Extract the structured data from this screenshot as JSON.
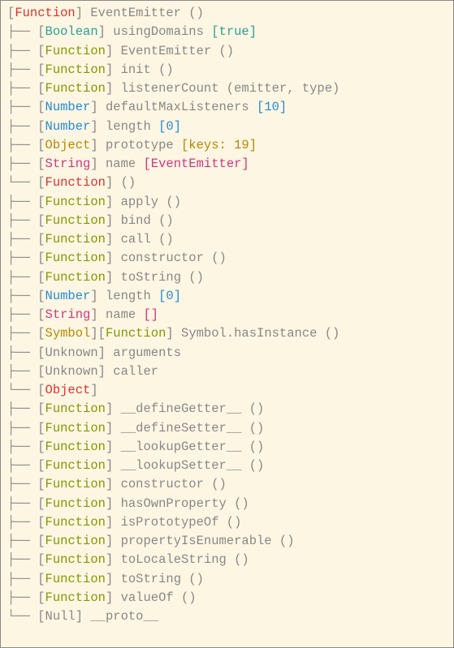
{
  "tree": [
    {
      "prefix": "",
      "types": [
        {
          "cls": "t-function-root",
          "label": "Function"
        }
      ],
      "name": "EventEmitter",
      "suffix": " ()"
    },
    {
      "prefix": "├── ",
      "types": [
        {
          "cls": "t-boolean",
          "label": "Boolean"
        }
      ],
      "name": "usingDomains",
      "suffix": " ",
      "valueCls": "val-bool",
      "value": "[true]"
    },
    {
      "prefix": "├── ",
      "types": [
        {
          "cls": "t-function",
          "label": "Function"
        }
      ],
      "name": "EventEmitter",
      "suffix": " ()"
    },
    {
      "prefix": "├── ",
      "types": [
        {
          "cls": "t-function",
          "label": "Function"
        }
      ],
      "name": "init",
      "suffix": " ()"
    },
    {
      "prefix": "├── ",
      "types": [
        {
          "cls": "t-function",
          "label": "Function"
        }
      ],
      "name": "listenerCount",
      "suffix": " (emitter, type)"
    },
    {
      "prefix": "├── ",
      "types": [
        {
          "cls": "t-number",
          "label": "Number"
        }
      ],
      "name": "defaultMaxListeners",
      "suffix": " ",
      "valueCls": "val-num",
      "value": "[10]"
    },
    {
      "prefix": "├── ",
      "types": [
        {
          "cls": "t-number",
          "label": "Number"
        }
      ],
      "name": "length",
      "suffix": " ",
      "valueCls": "val-num",
      "value": "[0]"
    },
    {
      "prefix": "├── ",
      "types": [
        {
          "cls": "t-object",
          "label": "Object"
        }
      ],
      "name": "prototype",
      "suffix": " ",
      "valueCls": "val-obj",
      "value": "[keys: 19]"
    },
    {
      "prefix": "├── ",
      "types": [
        {
          "cls": "t-string",
          "label": "String"
        }
      ],
      "name": "name",
      "suffix": " ",
      "valueCls": "val-str",
      "value": "[EventEmitter]"
    },
    {
      "prefix": "└── ",
      "types": [
        {
          "cls": "t-function-root",
          "label": "Function"
        }
      ],
      "name": "",
      "suffix": "()"
    },
    {
      "prefix": "    ├── ",
      "types": [
        {
          "cls": "t-function",
          "label": "Function"
        }
      ],
      "name": "apply",
      "suffix": " ()"
    },
    {
      "prefix": "    ├── ",
      "types": [
        {
          "cls": "t-function",
          "label": "Function"
        }
      ],
      "name": "bind",
      "suffix": " ()"
    },
    {
      "prefix": "    ├── ",
      "types": [
        {
          "cls": "t-function",
          "label": "Function"
        }
      ],
      "name": "call",
      "suffix": " ()"
    },
    {
      "prefix": "    ├── ",
      "types": [
        {
          "cls": "t-function",
          "label": "Function"
        }
      ],
      "name": "constructor",
      "suffix": " ()"
    },
    {
      "prefix": "    ├── ",
      "types": [
        {
          "cls": "t-function",
          "label": "Function"
        }
      ],
      "name": "toString",
      "suffix": " ()"
    },
    {
      "prefix": "    ├── ",
      "types": [
        {
          "cls": "t-number",
          "label": "Number"
        }
      ],
      "name": "length",
      "suffix": " ",
      "valueCls": "val-num",
      "value": "[0]"
    },
    {
      "prefix": "    ├── ",
      "types": [
        {
          "cls": "t-string",
          "label": "String"
        }
      ],
      "name": "name",
      "suffix": " ",
      "valueCls": "val-str",
      "value": "[]"
    },
    {
      "prefix": "    ├── ",
      "types": [
        {
          "cls": "t-symbol",
          "label": "Symbol"
        },
        {
          "cls": "t-function",
          "label": "Function"
        }
      ],
      "name": "Symbol.hasInstance",
      "suffix": " ()"
    },
    {
      "prefix": "    ├── ",
      "types": [
        {
          "cls": "t-unknown",
          "label": "Unknown"
        }
      ],
      "name": "arguments",
      "suffix": ""
    },
    {
      "prefix": "    ├── ",
      "types": [
        {
          "cls": "t-unknown",
          "label": "Unknown"
        }
      ],
      "name": "caller",
      "suffix": ""
    },
    {
      "prefix": "    └── ",
      "types": [
        {
          "cls": "t-object-root",
          "label": "Object"
        }
      ],
      "name": "",
      "suffix": ""
    },
    {
      "prefix": "        ├── ",
      "types": [
        {
          "cls": "t-function",
          "label": "Function"
        }
      ],
      "name": "__defineGetter__",
      "suffix": " ()"
    },
    {
      "prefix": "        ├── ",
      "types": [
        {
          "cls": "t-function",
          "label": "Function"
        }
      ],
      "name": "__defineSetter__",
      "suffix": " ()"
    },
    {
      "prefix": "        ├── ",
      "types": [
        {
          "cls": "t-function",
          "label": "Function"
        }
      ],
      "name": "__lookupGetter__",
      "suffix": " ()"
    },
    {
      "prefix": "        ├── ",
      "types": [
        {
          "cls": "t-function",
          "label": "Function"
        }
      ],
      "name": "__lookupSetter__",
      "suffix": " ()"
    },
    {
      "prefix": "        ├── ",
      "types": [
        {
          "cls": "t-function",
          "label": "Function"
        }
      ],
      "name": "constructor",
      "suffix": " ()"
    },
    {
      "prefix": "        ├── ",
      "types": [
        {
          "cls": "t-function",
          "label": "Function"
        }
      ],
      "name": "hasOwnProperty",
      "suffix": " ()"
    },
    {
      "prefix": "        ├── ",
      "types": [
        {
          "cls": "t-function",
          "label": "Function"
        }
      ],
      "name": "isPrototypeOf",
      "suffix": " ()"
    },
    {
      "prefix": "        ├── ",
      "types": [
        {
          "cls": "t-function",
          "label": "Function"
        }
      ],
      "name": "propertyIsEnumerable",
      "suffix": " ()"
    },
    {
      "prefix": "        ├── ",
      "types": [
        {
          "cls": "t-function",
          "label": "Function"
        }
      ],
      "name": "toLocaleString",
      "suffix": " ()"
    },
    {
      "prefix": "        ├── ",
      "types": [
        {
          "cls": "t-function",
          "label": "Function"
        }
      ],
      "name": "toString",
      "suffix": " ()"
    },
    {
      "prefix": "        ├── ",
      "types": [
        {
          "cls": "t-function",
          "label": "Function"
        }
      ],
      "name": "valueOf",
      "suffix": " ()"
    },
    {
      "prefix": "        └── ",
      "types": [
        {
          "cls": "t-null",
          "label": "Null"
        }
      ],
      "name": "__proto__",
      "suffix": ""
    }
  ]
}
